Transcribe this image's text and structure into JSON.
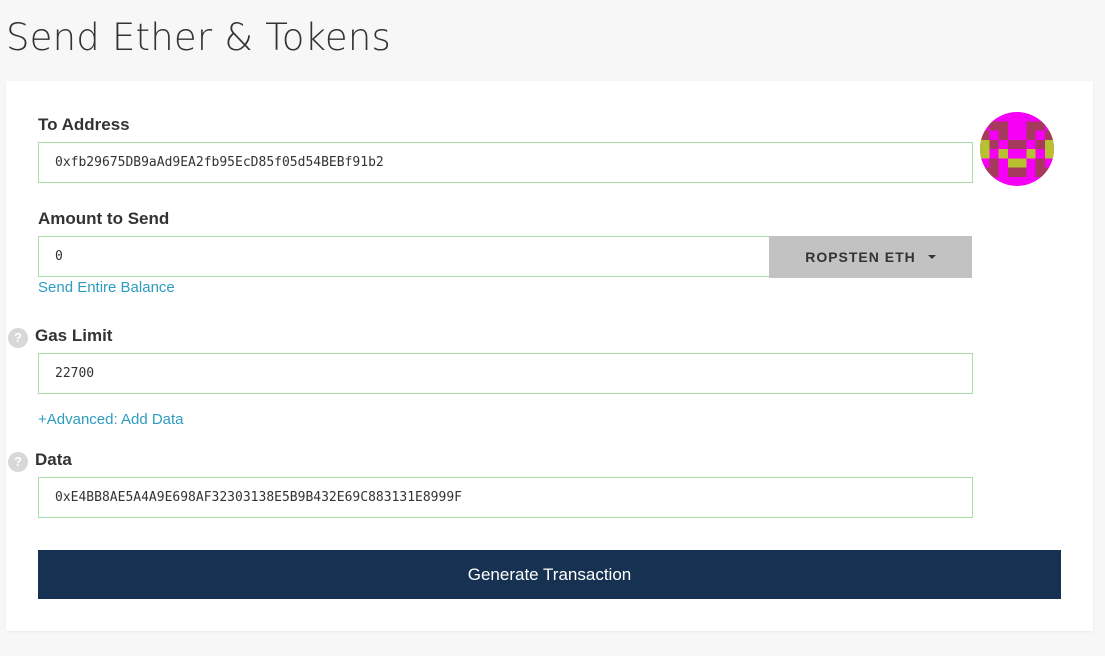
{
  "page": {
    "title": "Send Ether & Tokens"
  },
  "to_address": {
    "label": "To Address",
    "value": "0xfb29675DB9aAd9EA2fb95EcD85f05d54BEBf91b2"
  },
  "amount": {
    "label": "Amount to Send",
    "value": "0",
    "unit_label": "ROPSTEN ETH",
    "send_entire_balance": "Send Entire Balance"
  },
  "gas_limit": {
    "help": "?",
    "label": "Gas Limit",
    "value": "22700",
    "advanced_link": "+Advanced: Add Data"
  },
  "data_field": {
    "help": "?",
    "label": "Data",
    "value": "0xE4BB8AE5A4A9E698AF32303138E5B9B432E69C883131E8999F"
  },
  "actions": {
    "generate": "Generate Transaction"
  },
  "colors": {
    "button_navy": "#163151",
    "link_blue": "#2e9cc0",
    "input_border_valid": "#a9dca6",
    "identicon_magenta": "#f500f5",
    "identicon_olive": "#b8c130",
    "identicon_maroon": "#a53a5c"
  },
  "icons": {
    "identicon": "address-identicon",
    "help": "question-circle-icon",
    "dropdown": "caret-down-icon"
  }
}
